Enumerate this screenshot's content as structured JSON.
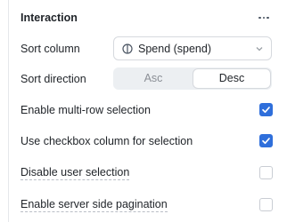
{
  "section": {
    "title": "Interaction"
  },
  "sort_column": {
    "label": "Sort column",
    "selected": "Spend (spend)",
    "icon": "column-icon"
  },
  "sort_direction": {
    "label": "Sort direction",
    "options": [
      "Asc",
      "Desc"
    ],
    "selected": "Desc"
  },
  "options": [
    {
      "label": "Enable multi-row selection",
      "checked": true
    },
    {
      "label": "Use checkbox column for selection",
      "checked": true
    },
    {
      "label": "Disable user selection",
      "checked": false
    },
    {
      "label": "Enable server side pagination",
      "checked": false
    }
  ],
  "colors": {
    "accent": "#2f6fdb"
  }
}
